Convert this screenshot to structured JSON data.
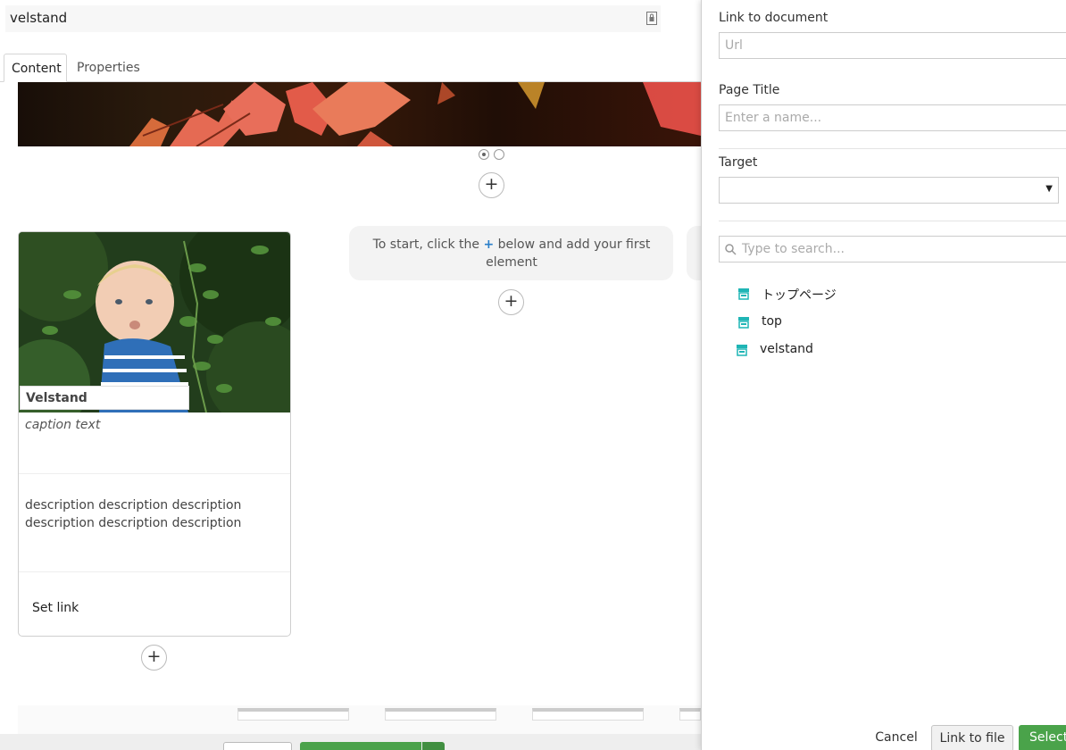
{
  "editor": {
    "node_name": "velstand",
    "tabs": [
      {
        "label": "Content",
        "active": true
      },
      {
        "label": "Properties",
        "active": false
      }
    ],
    "carousel_dots": 2,
    "card": {
      "title": "Velstand",
      "caption": "caption text",
      "description": "description description description description description description",
      "link_label": "Set link"
    },
    "empty_area": {
      "text_before": "To start, click the",
      "plus": "+",
      "text_after": "below and add your first element"
    }
  },
  "panel": {
    "link_label": "Link to document",
    "url_placeholder": "Url",
    "page_title_label": "Page Title",
    "page_title_placeholder": "Enter a name...",
    "target_label": "Target",
    "target_value": "",
    "search_placeholder": "Type to search...",
    "tree": [
      {
        "label": "トップページ",
        "icon": "store-icon"
      },
      {
        "label": "top",
        "icon": "store-icon"
      },
      {
        "label": "velstand",
        "icon": "store-icon"
      }
    ],
    "buttons": {
      "cancel": "Cancel",
      "link_to_file": "Link to file",
      "select": "Select"
    }
  },
  "colors": {
    "accent_teal": "#1fb5b5",
    "success_green": "#4aa34a",
    "plus_blue": "#2a7fc9"
  }
}
